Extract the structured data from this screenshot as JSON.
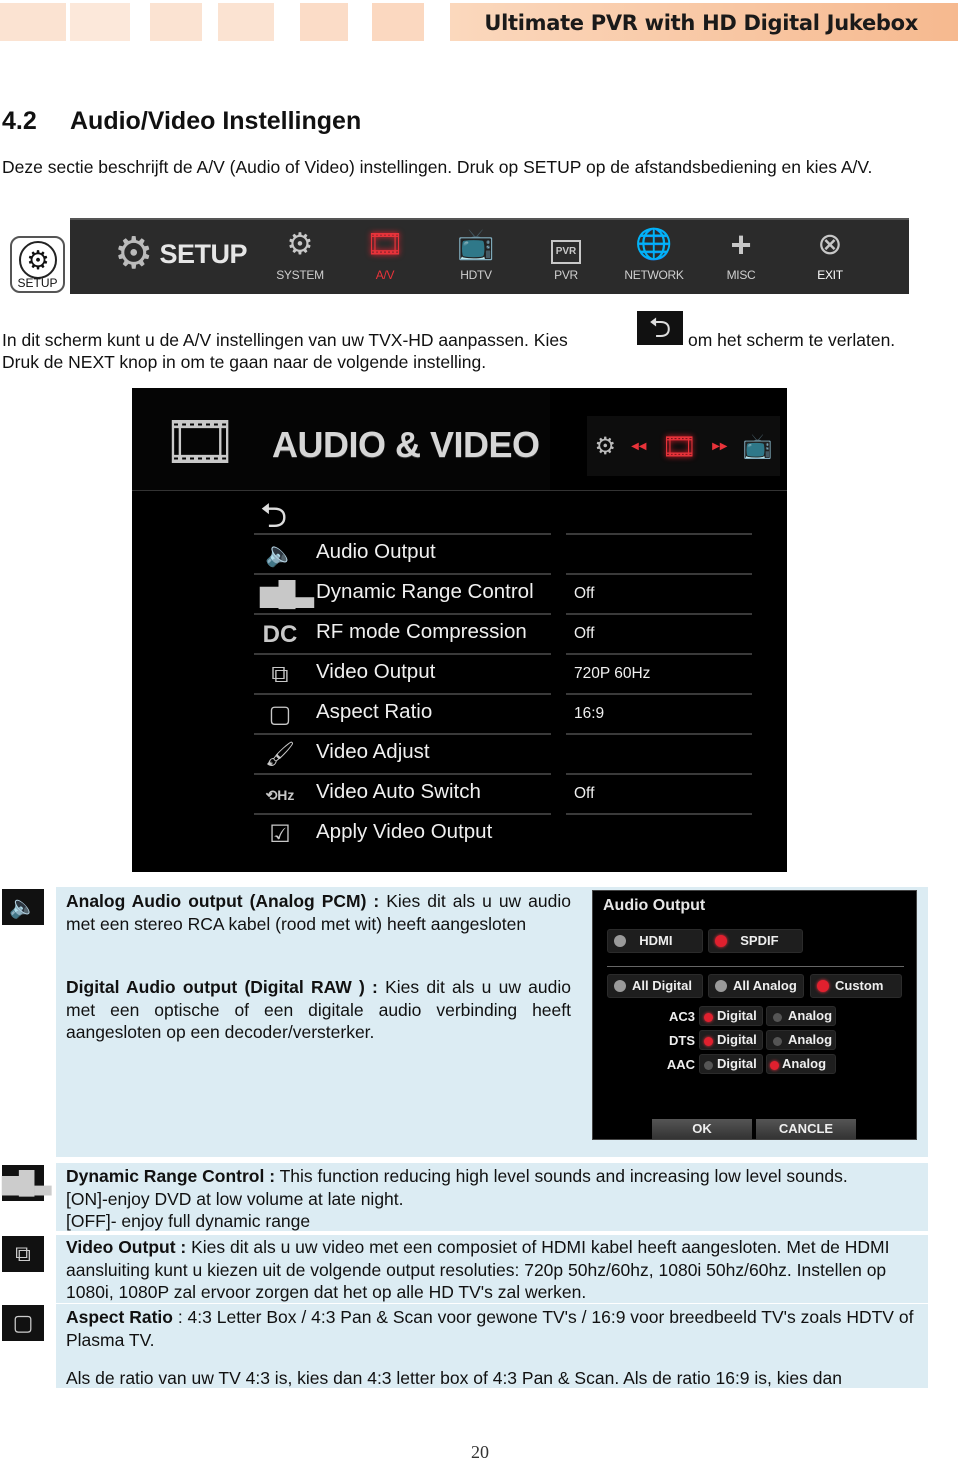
{
  "header": {
    "title": "Ultimate PVR with HD Digital Jukebox"
  },
  "section": {
    "number": "4.2",
    "title": "Audio/Video Instellingen",
    "intro": "Deze sectie beschrijft  de A/V (Audio of Video) instellingen. Druk op SETUP op de afstandsbediening en kies A/V.",
    "instruction_before": "In dit scherm kunt u de A/V instellingen van uw TVX-HD aanpassen. Kies",
    "instruction_after": "om het scherm te verlaten.",
    "instruction_line2": "Druk de NEXT knop in om te gaan naar de volgende instelling.",
    "back_icon": "back-arrow-icon"
  },
  "remote_button": {
    "label": "SETUP",
    "icon": "gear-icon"
  },
  "setup_menu": {
    "title": "SETUP",
    "items": [
      {
        "label": "SYSTEM",
        "icon": "gears-icon",
        "active": false
      },
      {
        "label": "A/V",
        "icon": "film-speaker-icon",
        "active": true
      },
      {
        "label": "HDTV",
        "icon": "tv-icon",
        "active": false
      },
      {
        "label": "PVR",
        "icon": "pvr-icon",
        "active": false
      },
      {
        "label": "NETWORK",
        "icon": "globe-icon",
        "active": false
      },
      {
        "label": "MISC",
        "icon": "plus-icon",
        "active": false
      },
      {
        "label": "EXIT",
        "icon": "close-icon",
        "active": false
      }
    ],
    "accent_color": "#e8333a"
  },
  "av_screen": {
    "title": "AUDIO & VIDEO",
    "rows": [
      {
        "label": "Audio Output",
        "value": "",
        "icon": "speaker-icon"
      },
      {
        "label": "Dynamic Range Control",
        "value": "Off",
        "icon": "bars-icon"
      },
      {
        "label": "RF mode Compression",
        "value": "Off",
        "icon": "dolby-icon"
      },
      {
        "label": "Video Output",
        "value": "720P 60Hz",
        "icon": "windows-icon"
      },
      {
        "label": "Aspect Ratio",
        "value": "16:9",
        "icon": "frame-icon"
      },
      {
        "label": "Video Adjust",
        "value": "",
        "icon": "brush-icon"
      },
      {
        "label": "Video Auto Switch",
        "value": "Off",
        "icon": "hz-switch-icon"
      },
      {
        "label": "Apply Video Output",
        "value": "",
        "icon": "monitor-check-icon"
      }
    ]
  },
  "audio_info": {
    "analog_bold": "Analog Audio output (Analog PCM) :",
    "analog_text": " Kies dit als u uw audio met een stereo RCA kabel (rood met wit) heeft aangesloten",
    "digital_bold": "Digital Audio output (Digital RAW ) :",
    "digital_text": " Kies dit als u uw audio met een optische of een digitale audio verbinding heeft aangesloten op een decoder/versterker."
  },
  "audio_dialog": {
    "title": "Audio Output",
    "outputs": [
      {
        "label": "HDMI",
        "selected": false
      },
      {
        "label": "SPDIF",
        "selected": true
      }
    ],
    "modes": [
      {
        "label": "All Digital",
        "selected": false
      },
      {
        "label": "All Analog",
        "selected": false
      },
      {
        "label": "Custom",
        "selected": true
      }
    ],
    "codecs": [
      {
        "name": "AC3",
        "digital": "Digital",
        "analog": "Analog",
        "selected": "digital"
      },
      {
        "name": "DTS",
        "digital": "Digital",
        "analog": "Analog",
        "selected": "digital"
      },
      {
        "name": "AAC",
        "digital": "Digital",
        "analog": "Analog",
        "selected": "analog"
      }
    ],
    "ok_label": "OK",
    "cancel_label": "CANCLE"
  },
  "drc_info": {
    "bold": "Dynamic Range Control :",
    "text": " This function reducing high level sounds and increasing low level sounds.",
    "line2": "[ON]-enjoy DVD at low volume at late night.",
    "line3": "[OFF]- enjoy full dynamic range"
  },
  "video_output_info": {
    "bold": "Video Output :",
    "text": " Kies dit als u uw video met een composiet of HDMI kabel heeft aangesloten. Met de HDMI aansluiting kunt u kiezen uit de volgende output resoluties: 720p 50hz/60hz, 1080i 50hz/60hz. Instellen op 1080i, 1080P zal ervoor zorgen dat het op alle HD TV's zal werken."
  },
  "aspect_info": {
    "bold": "Aspect Ratio",
    "text": " :  4:3 Letter Box / 4:3 Pan & Scan voor gewone TV's / 16:9 voor breedbeeld TV's zoals HDTV of Plasma TV.",
    "para2": "Als de ratio van uw TV 4:3 is, kies dan 4:3 letter box of 4:3 Pan & Scan. Als de ratio 16:9 is, kies dan"
  },
  "page_number": "20"
}
